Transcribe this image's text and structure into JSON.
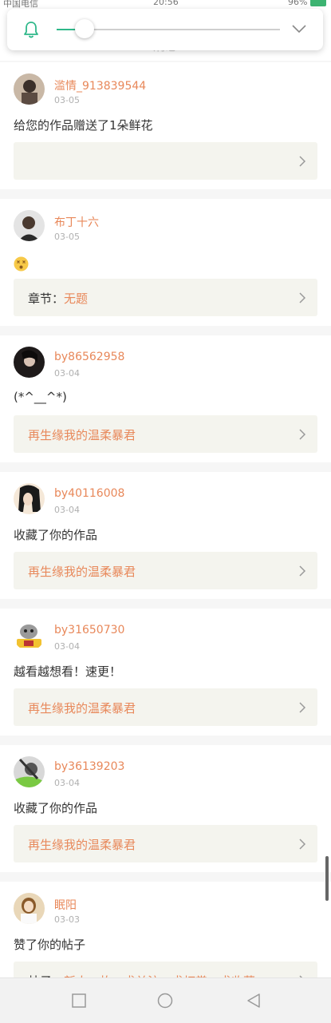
{
  "status_bar": {
    "carrier": "中国电信",
    "time": "20:56",
    "battery": "96%"
  },
  "header": {
    "title": "消息"
  },
  "volume": {
    "level": 0.12
  },
  "notifications": [
    {
      "user": "滥情_913839544",
      "date": "03-05",
      "content": "给您的作品赠送了1朵鲜花",
      "ref_prefix": "",
      "ref_title": ""
    },
    {
      "user": "布丁十六",
      "date": "03-05",
      "content": "",
      "emoji": "dizzy-face-emoji",
      "ref_prefix": "章节：",
      "ref_title": "无题"
    },
    {
      "user": "by86562958",
      "date": "03-04",
      "content": "(*^__^*)",
      "ref_prefix": "",
      "ref_title": "再生缘我的温柔暴君"
    },
    {
      "user": "by40116008",
      "date": "03-04",
      "content": "收藏了你的作品",
      "ref_prefix": "",
      "ref_title": "再生缘我的温柔暴君"
    },
    {
      "user": "by31650730",
      "date": "03-04",
      "content": "越看越想看！速更！",
      "ref_prefix": "",
      "ref_title": "再生缘我的温柔暴君"
    },
    {
      "user": "by36139203",
      "date": "03-04",
      "content": "收藏了你的作品",
      "ref_prefix": "",
      "ref_title": "再生缘我的温柔暴君"
    },
    {
      "user": "眠阳",
      "date": "03-03",
      "content": "赞了你的帖子",
      "ref_prefix": "帖子：",
      "ref_title": "新人一枚，求关注，求打赏，求收藏"
    }
  ],
  "colors": {
    "accent": "#e8885a",
    "ref_bg": "#f4f4ee",
    "slider": "#2fb88a"
  }
}
